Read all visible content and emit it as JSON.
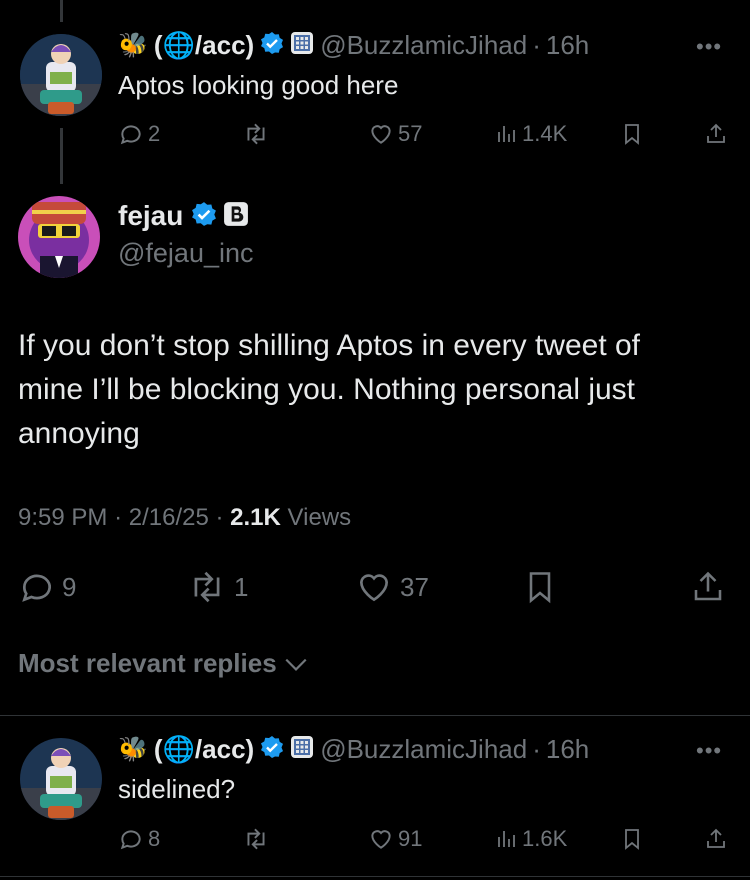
{
  "reply_top": {
    "display_name": "(🌐/acc)",
    "handle": "@BuzzlamicJihad",
    "time": "16h",
    "text": "Aptos looking good here",
    "replies": "2",
    "retweets": "",
    "likes": "57",
    "views": "1.4K"
  },
  "main_tweet": {
    "display_name": "fejau",
    "handle": "@fejau_inc",
    "text_lines": [
      "If you don’t stop shilling Aptos in every tweet of",
      "mine I’ll be blocking you. Nothing personal just",
      "annoying"
    ],
    "time": "9:59 PM",
    "date": "2/16/25",
    "views_count": "2.1K",
    "views_label": "Views",
    "replies": "9",
    "retweets": "1",
    "likes": "37"
  },
  "sort_label": "Most relevant replies",
  "reply_bottom": {
    "display_name": "(🌐/acc)",
    "handle": "@BuzzlamicJihad",
    "time": "16h",
    "text": "sidelined?",
    "replies": "8",
    "retweets": "",
    "likes": "91",
    "views": "1.6K"
  },
  "colors": {
    "background": "#000000",
    "text": "#e7e9ea",
    "muted": "#71767b",
    "verified": "#1d9bf0"
  },
  "icons": [
    "bee-icon",
    "verified-badge-icon",
    "grid-badge-icon",
    "comment-icon",
    "retweet-icon",
    "heart-icon",
    "views-icon",
    "bookmark-icon",
    "share-icon",
    "chevron-down-icon",
    "more-icon"
  ]
}
